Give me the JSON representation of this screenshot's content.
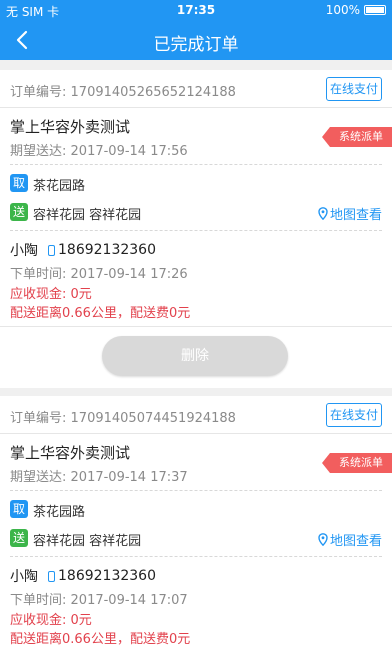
{
  "status_bar": {
    "carrier": "无 SIM 卡",
    "time": "17:35",
    "battery": "100%"
  },
  "nav": {
    "title": "已完成订单"
  },
  "orders": [
    {
      "order_label": "订单编号:",
      "order_no": "17091405265652124188",
      "pay_tag": "在线支付",
      "shop": "掌上华容外卖测试",
      "expected_label": "期望送达:",
      "expected_time": "2017-09-14 17:56",
      "dispatch_tag": "系统派单",
      "pickup_tag": "取",
      "pickup_addr": "茶花园路",
      "send_tag": "送",
      "send_addr": "容祥花园 容祥花园",
      "map_link": "地图查看",
      "customer_name": "小陶",
      "customer_phone": "18692132360",
      "order_time_label": "下单时间:",
      "order_time": "2017-09-14 17:26",
      "cash_label": "应收现金:",
      "cash_value": "0元",
      "distance_text": "配送距离0.66公里，配送费0元",
      "delete_label": "删除"
    },
    {
      "order_label": "订单编号:",
      "order_no": "17091405074451924188",
      "pay_tag": "在线支付",
      "shop": "掌上华容外卖测试",
      "expected_label": "期望送达:",
      "expected_time": "2017-09-14 17:37",
      "dispatch_tag": "系统派单",
      "pickup_tag": "取",
      "pickup_addr": "茶花园路",
      "send_tag": "送",
      "send_addr": "容祥花园 容祥花园",
      "map_link": "地图查看",
      "customer_name": "小陶",
      "customer_phone": "18692132360",
      "order_time_label": "下单时间:",
      "order_time": "2017-09-14 17:07",
      "cash_label": "应收现金:",
      "cash_value": "0元",
      "distance_text": "配送距离0.66公里，配送费0元"
    }
  ],
  "colors": {
    "primary": "#2196f3",
    "dispatch": "#f25e5e",
    "send_tag": "#3cb54a",
    "alert_text": "#e2414c"
  },
  "icons": {
    "back": "chevron-left-icon",
    "location": "location-pin-icon",
    "phone": "phone-icon"
  }
}
